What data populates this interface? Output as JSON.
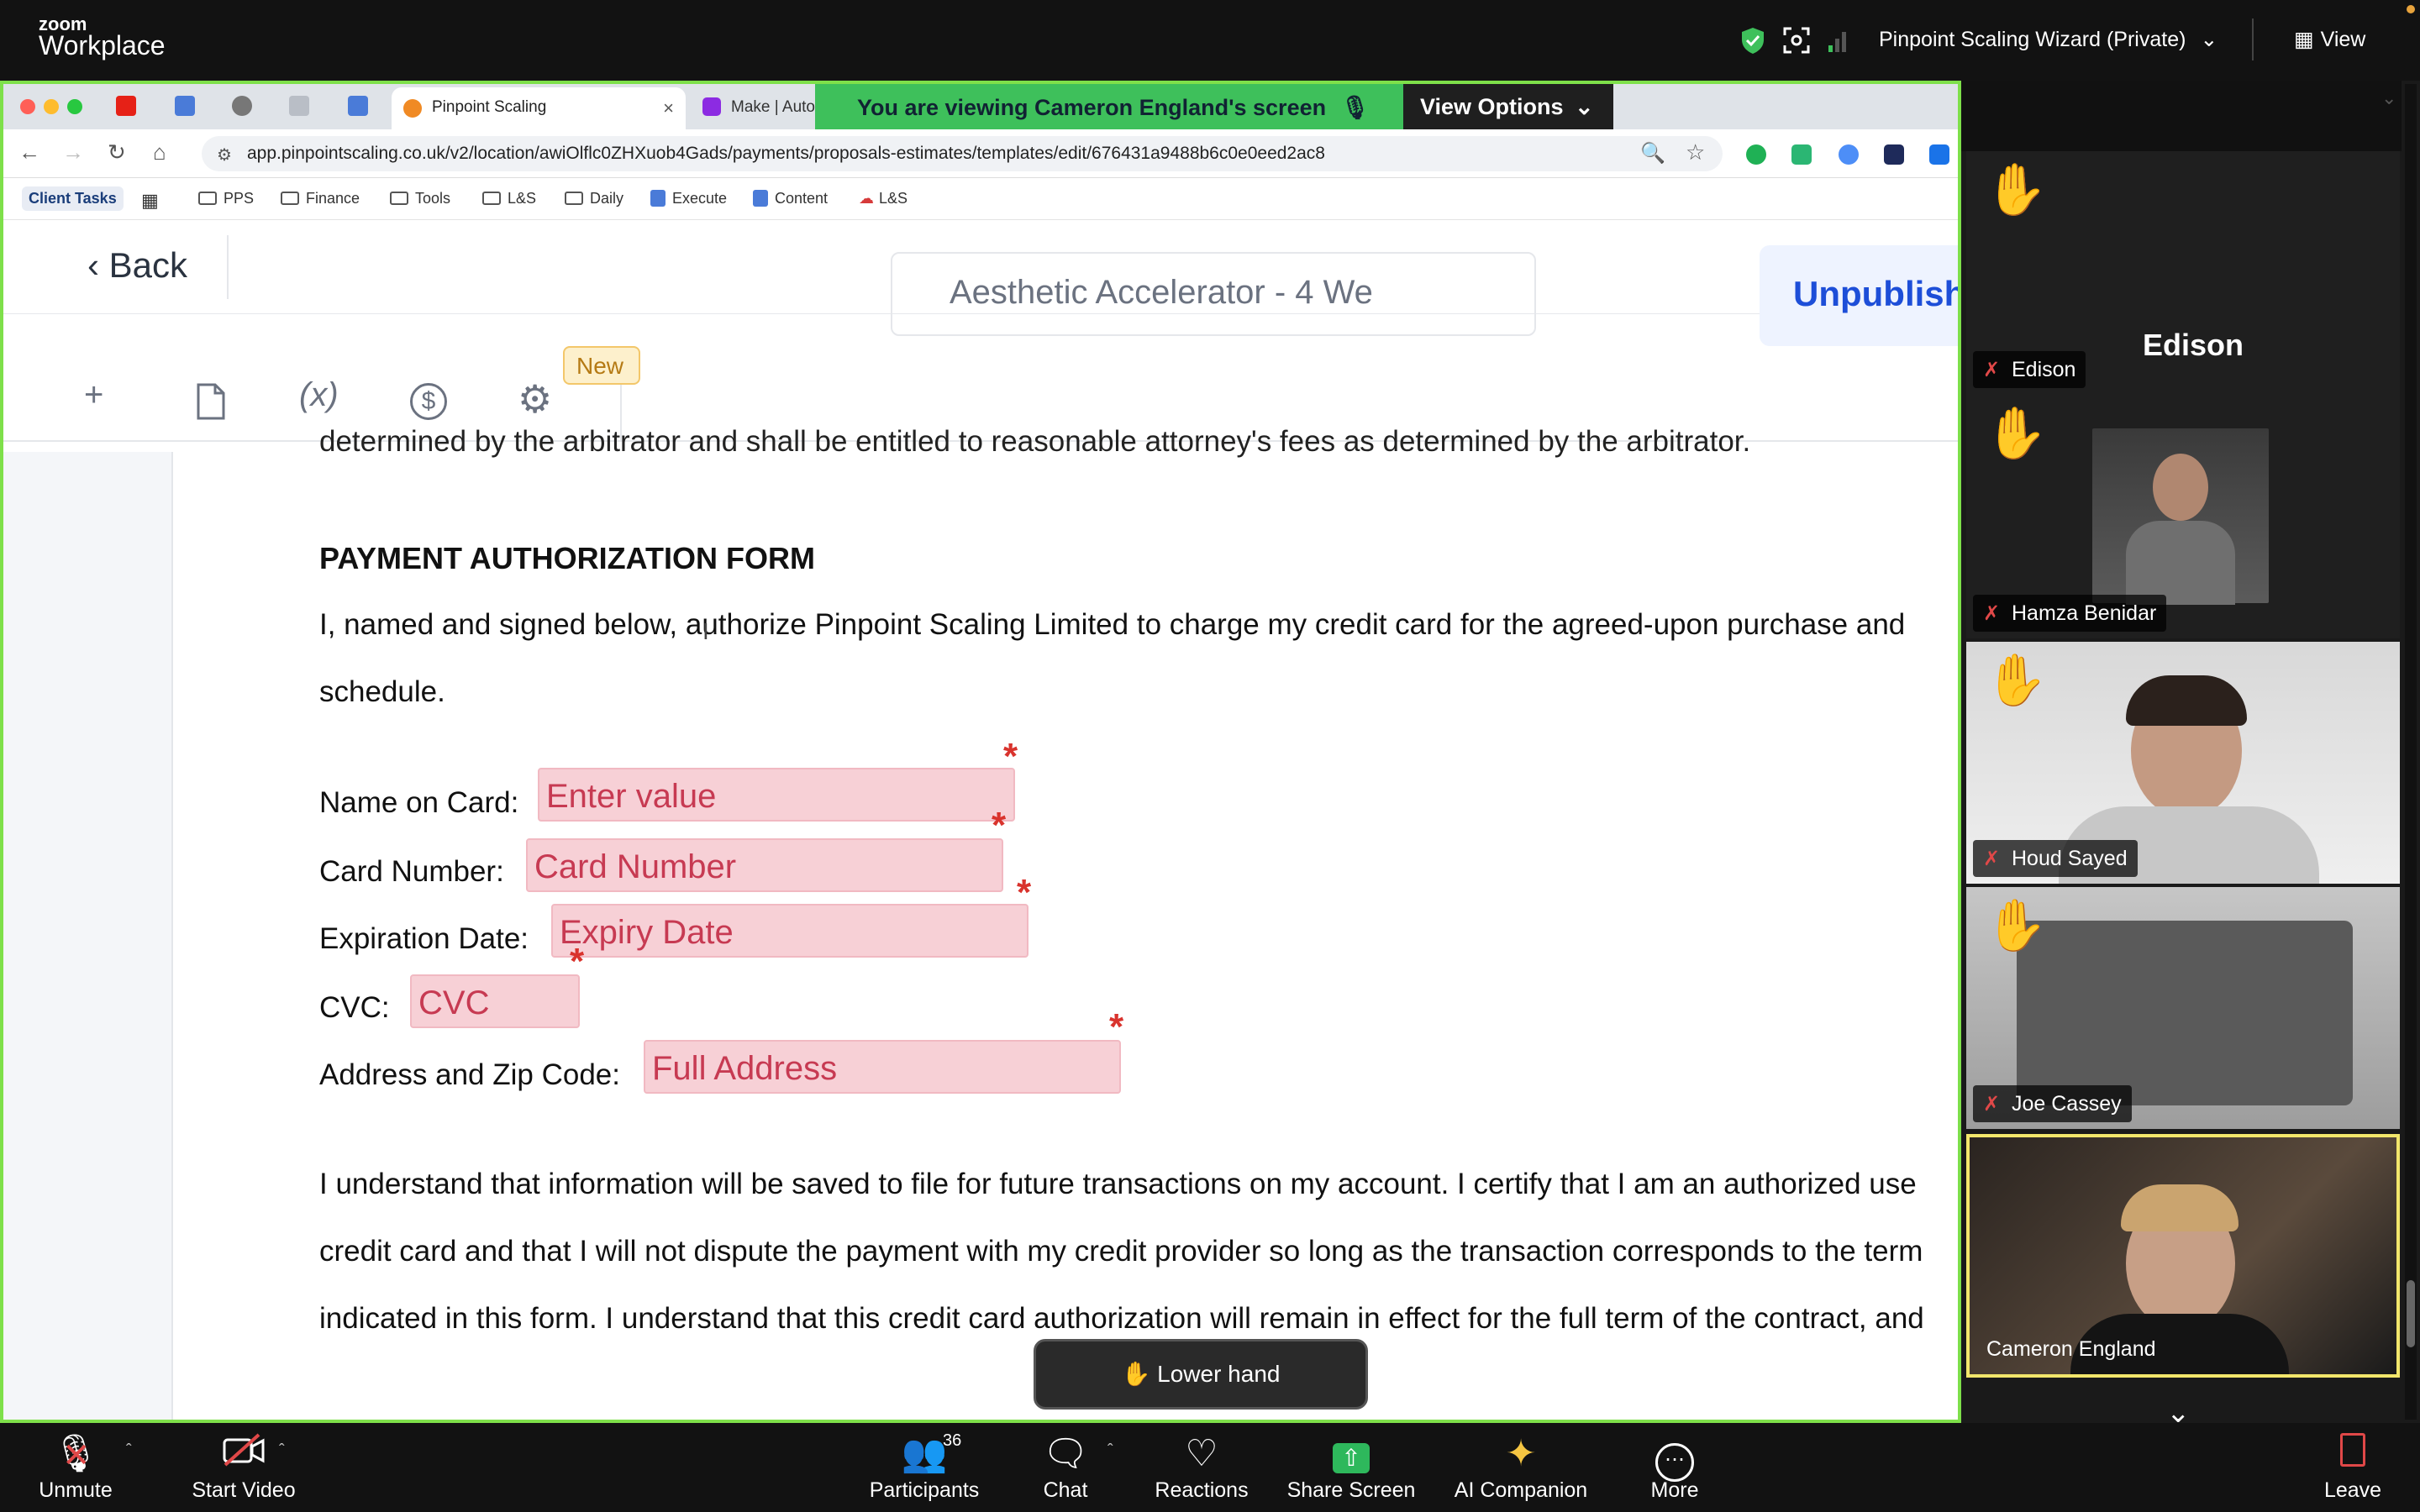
{
  "zoom": {
    "logo_small": "zoom",
    "logo_big": "Workplace",
    "meeting_title": "Pinpoint Scaling Wizard (Private)",
    "view_label": "View"
  },
  "browser": {
    "active_tab": "Pinpoint Scaling",
    "tab2": "Make | Auto",
    "viewing_banner": "You are viewing  Cameron England's screen",
    "view_options": "View Options",
    "url": "app.pinpointscaling.co.uk/v2/location/awiOlflc0ZHXuob4Gads/payments/proposals-estimates/templates/edit/676431a9488b6c0e0eed2ac8",
    "bookmarks": [
      "Client Tasks",
      "PPS",
      "Finance",
      "Tools",
      "L&S",
      "Daily",
      "Execute",
      "Content",
      "L&S"
    ]
  },
  "app": {
    "back_label": "Back",
    "title_value": "Aesthetic Accelerator - 4 We",
    "unpublish_label": "Unpublish",
    "tools": [
      "+",
      "(x)",
      "$"
    ],
    "new_badge": "New"
  },
  "doc": {
    "cut_line": "determined by the arbitrator and shall be entitled to reasonable attorney's fees as determined by the arbitrator.",
    "heading": "PAYMENT AUTHORIZATION FORM",
    "auth_line1": "I, named and signed below, authorize Pinpoint Scaling Limited to charge my credit card for the agreed-upon purchase and",
    "auth_line2": "schedule.",
    "fields": [
      {
        "label": "Name on Card:",
        "placeholder": "Enter value"
      },
      {
        "label": "Card Number:",
        "placeholder": "Card Number"
      },
      {
        "label": "Expiration Date:",
        "placeholder": "Expiry Date"
      },
      {
        "label": "CVC:",
        "placeholder": "CVC"
      },
      {
        "label": "Address and Zip Code:",
        "placeholder": "Full Address"
      }
    ],
    "required_mark": "*",
    "und1": "I understand that information will be saved to file for future transactions on my account. I certify that I am an authorized use",
    "und2": "credit card and that I will not dispute the payment with my credit provider so long as the transaction corresponds to the term",
    "und3": "indicated in this form. I understand that this credit card authorization will remain in effect for the full term of the contract, and"
  },
  "lower_hand": "✋ Lower hand",
  "participants_panel": {
    "tiles": [
      {
        "name": "Edison",
        "big_name": "Edison"
      },
      {
        "name": "Hamza Benidar"
      },
      {
        "name": "Houd Sayed"
      },
      {
        "name": "Joe Cassey"
      },
      {
        "name": "Cameron England"
      }
    ]
  },
  "toolbar": {
    "unmute": "Unmute",
    "start_video": "Start Video",
    "participants": "Participants",
    "participants_count": "36",
    "chat": "Chat",
    "reactions": "Reactions",
    "share_screen": "Share Screen",
    "ai_companion": "AI Companion",
    "more": "More",
    "leave": "Leave"
  },
  "colors": {
    "share_border": "#7ee04a",
    "banner": "#3ec05b",
    "field_bg": "#f7d0d6",
    "field_text": "#c73a52",
    "required": "#d9332d",
    "accent_blue": "#1d4ed8"
  }
}
